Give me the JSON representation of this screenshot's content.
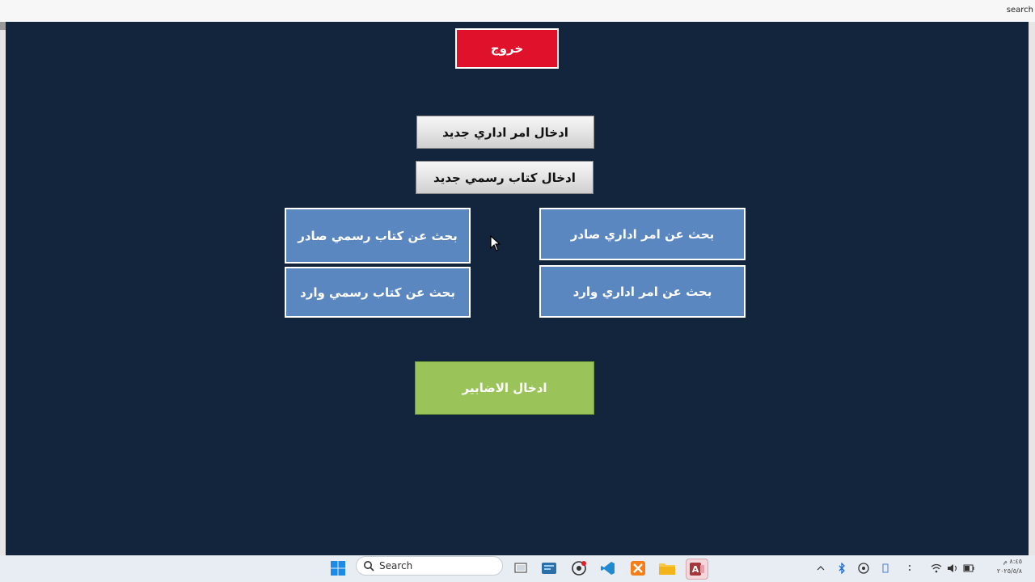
{
  "window": {
    "search_label": "search"
  },
  "menu": {
    "exit": "خروج",
    "new_admin_order": "ادخال امر اداري جديد",
    "new_official_letter": "ادخال كتاب رسمي جديد",
    "search_letter_outgoing": "بحث عن كتاب رسمي صادر",
    "search_letter_incoming": "بحث عن كتاب رسمي وارد",
    "search_order_outgoing": "بحث عن امر اداري صادر",
    "search_order_incoming": "بحث عن امر اداري وارد",
    "enter_folders": "ادخال الاضابير"
  },
  "colors": {
    "form_bg": "#13253d",
    "exit": "#e0112b",
    "search_buttons": "#5b87c0",
    "folders_button": "#9ac45a"
  },
  "taskbar": {
    "search_placeholder": "Search",
    "apps": [
      "windows-start-icon",
      "task-view-icon",
      "widgets-icon",
      "chrome-icon",
      "vscode-icon",
      "xampp-icon",
      "file-explorer-icon",
      "access-icon"
    ],
    "clock_time": "٨:٤٥ م",
    "clock_date": "٢٠٢٥/٥/٨"
  }
}
